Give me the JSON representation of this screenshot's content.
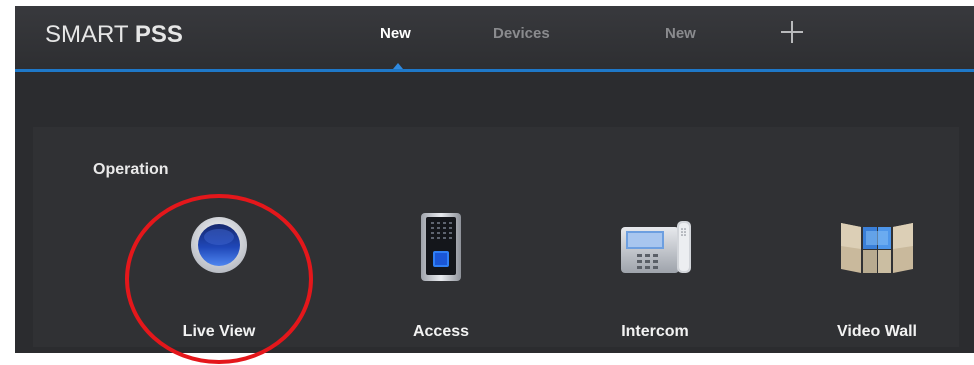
{
  "header": {
    "brand_light": "SMART ",
    "brand_bold": "PSS",
    "tabs": [
      {
        "label": "New",
        "active": true
      },
      {
        "label": "Devices",
        "active": false
      },
      {
        "label": "New",
        "active": false
      }
    ],
    "add_tab_icon": "plus-icon"
  },
  "main": {
    "section_title": "Operation",
    "items": [
      {
        "label": "Live View",
        "icon": "live-view-icon",
        "highlighted": true
      },
      {
        "label": "Access",
        "icon": "access-control-icon",
        "highlighted": false
      },
      {
        "label": "Intercom",
        "icon": "intercom-phone-icon",
        "highlighted": false
      },
      {
        "label": "Video Wall",
        "icon": "video-wall-icon",
        "highlighted": false
      }
    ]
  },
  "colors": {
    "accent": "#1e78c8",
    "annotation": "#e4171b",
    "background": "#2a2b2e"
  }
}
